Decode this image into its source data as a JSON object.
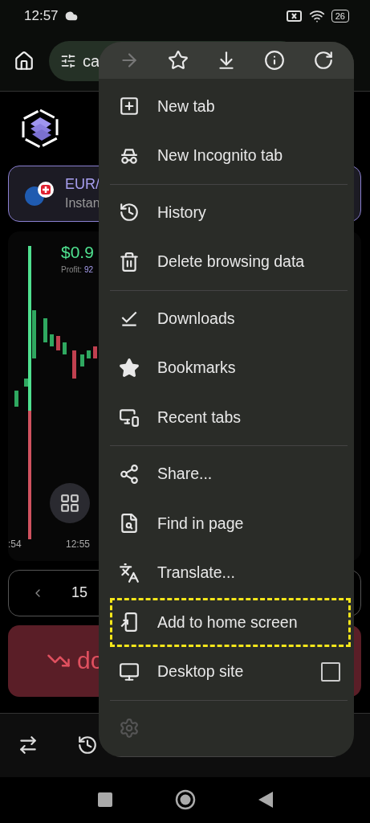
{
  "status_bar": {
    "time": "12:57",
    "battery": "26"
  },
  "address_bar": {
    "url": "ca"
  },
  "page": {
    "pair": "EUR/",
    "subtitle": "Instan",
    "amount": "$0.9",
    "profit_label": "Profit:",
    "profit_value": "92",
    "time_labels": [
      ":54",
      "12:55"
    ],
    "stake": "15",
    "trade_button": "do"
  },
  "menu": {
    "toolbar": [
      {
        "kind": "forward",
        "disabled": true
      },
      {
        "kind": "bookmark",
        "disabled": false
      },
      {
        "kind": "download",
        "disabled": false
      },
      {
        "kind": "info",
        "disabled": false
      },
      {
        "kind": "refresh",
        "disabled": false
      }
    ],
    "groups": [
      [
        {
          "label": "New tab",
          "highlighted": false
        },
        {
          "label": "New Incognito tab",
          "highlighted": false
        }
      ],
      [
        {
          "label": "History",
          "highlighted": false
        },
        {
          "label": "Delete browsing data",
          "highlighted": false
        }
      ],
      [
        {
          "label": "Downloads",
          "highlighted": false
        },
        {
          "label": "Bookmarks",
          "highlighted": false
        },
        {
          "label": "Recent tabs",
          "highlighted": false
        }
      ],
      [
        {
          "label": "Share...",
          "highlighted": false
        },
        {
          "label": "Find in page",
          "highlighted": false
        },
        {
          "label": "Translate...",
          "highlighted": false
        },
        {
          "label": "Add to home screen",
          "highlighted": true
        },
        {
          "label": "Desktop site",
          "highlighted": false,
          "checked": false
        }
      ],
      [
        {
          "highlighted": false,
          "faded": true
        }
      ]
    ]
  }
}
